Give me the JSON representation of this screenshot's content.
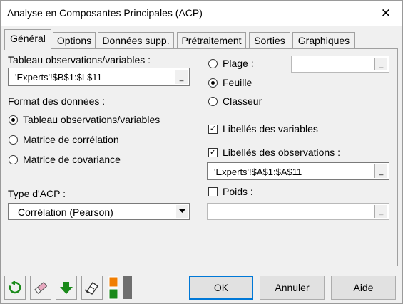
{
  "window": {
    "title": "Analyse en Composantes Principales (ACP)"
  },
  "tabs": [
    {
      "label": "Général"
    },
    {
      "label": "Options"
    },
    {
      "label": "Données supp."
    },
    {
      "label": "Prétraitement"
    },
    {
      "label": "Sorties"
    },
    {
      "label": "Graphiques"
    }
  ],
  "general": {
    "obs_var_label": "Tableau observations/variables :",
    "obs_var_value": "'Experts'!$B$1:$L$11",
    "format_label": "Format des données :",
    "format_options": [
      {
        "label": "Tableau observations/variables",
        "selected": true
      },
      {
        "label": "Matrice de corrélation",
        "selected": false
      },
      {
        "label": "Matrice de covariance",
        "selected": false
      }
    ],
    "pca_type_label": "Type d'ACP :",
    "pca_type_value": "Corrélation (Pearson)",
    "range_options": [
      {
        "label": "Plage :",
        "selected": false
      },
      {
        "label": "Feuille",
        "selected": true
      },
      {
        "label": "Classeur",
        "selected": false
      }
    ],
    "range_value": "",
    "var_labels": {
      "label": "Libellés des variables",
      "checked": true
    },
    "obs_labels": {
      "label": "Libellés des observations :",
      "checked": true
    },
    "obs_labels_value": "'Experts'!$A$1:$A$11",
    "weights": {
      "label": "Poids :",
      "checked": false
    },
    "weights_value": ""
  },
  "buttons": {
    "ok": "OK",
    "cancel": "Annuler",
    "help": "Aide",
    "ref": "_",
    "close": "✕",
    "check_mark": "✓"
  },
  "toolbar_icons": [
    "reset-icon",
    "eraser-icon",
    "arrow-down-icon",
    "load-icon",
    "layout-toggle-icon"
  ],
  "colors": {
    "accent": "#0078d7",
    "green": "#1a8a1a",
    "orange": "#f07d00"
  }
}
